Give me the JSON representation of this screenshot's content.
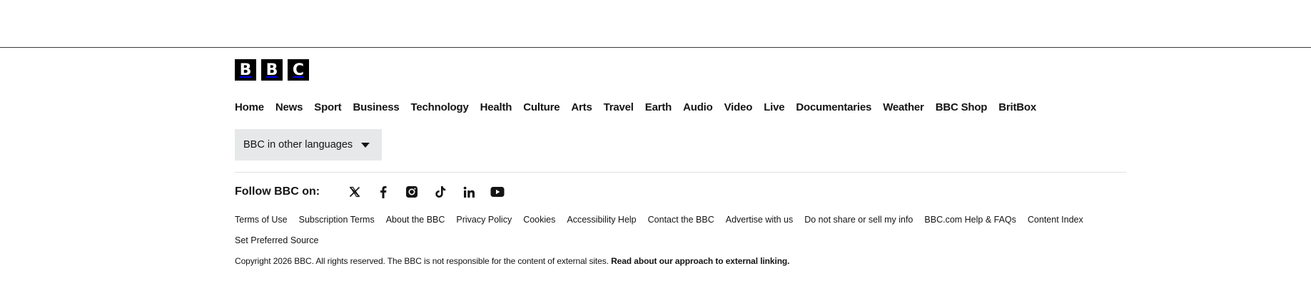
{
  "logo": {
    "letters": [
      "B",
      "B",
      "C"
    ],
    "alt": "BBC"
  },
  "nav": {
    "items": [
      "Home",
      "News",
      "Sport",
      "Business",
      "Technology",
      "Health",
      "Culture",
      "Arts",
      "Travel",
      "Earth",
      "Audio",
      "Video",
      "Live",
      "Documentaries",
      "Weather",
      "BBC Shop",
      "BritBox"
    ]
  },
  "languages": {
    "label": "BBC in other languages",
    "icon": "caret-down-icon"
  },
  "follow": {
    "label": "Follow BBC on:",
    "icons": [
      "x-icon",
      "facebook-icon",
      "instagram-icon",
      "tiktok-icon",
      "linkedin-icon",
      "youtube-icon"
    ]
  },
  "footer_links": [
    "Terms of Use",
    "Subscription Terms",
    "About the BBC",
    "Privacy Policy",
    "Cookies",
    "Accessibility Help",
    "Contact the BBC",
    "Advertise with us",
    "Do not share or sell my info",
    "BBC.com Help & FAQs",
    "Content Index",
    "Set Preferred Source"
  ],
  "copyright": {
    "text": "Copyright 2026 BBC. All rights reserved. The BBC is not responsible for the content of external sites.",
    "link": "Read about our approach to external linking."
  }
}
